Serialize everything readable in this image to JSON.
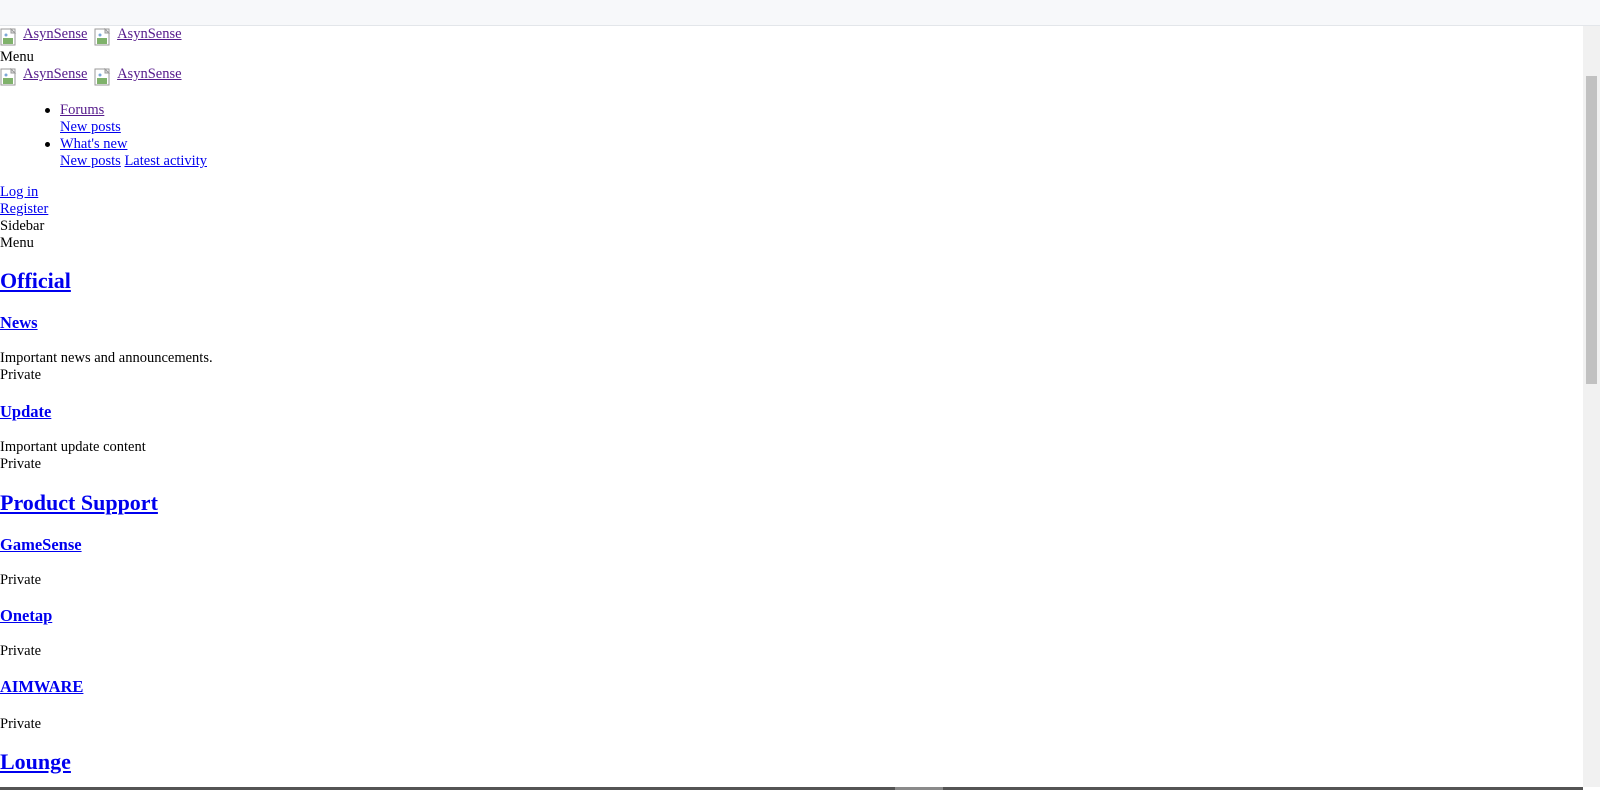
{
  "header": {
    "logo_alt": "AsynSense",
    "menu_label": "Menu"
  },
  "nav": {
    "forums": "Forums",
    "forums_new_posts": "New posts",
    "whats_new": "What's new",
    "whats_new_new_posts": "New posts",
    "latest_activity": "Latest activity"
  },
  "account": {
    "login": "Log in",
    "register": "Register"
  },
  "offcanvas": {
    "sidebar_label": "Sidebar",
    "menu_label": "Menu"
  },
  "categories": [
    {
      "title": "Official",
      "forums": [
        {
          "title": "News",
          "description": "Important news and announcements.",
          "status": "Private"
        },
        {
          "title": "Update",
          "description": "Important update content",
          "status": "Private"
        }
      ]
    },
    {
      "title": "Product Support",
      "forums": [
        {
          "title": "GameSense",
          "status": "Private"
        },
        {
          "title": "Onetap",
          "status": "Private"
        },
        {
          "title": "AIMWARE",
          "status": "Private"
        }
      ]
    },
    {
      "title": "Lounge"
    }
  ],
  "colors": {
    "link": "#0000ee",
    "visited_link": "#551a8b",
    "topbar_bg": "#f7f8fa",
    "scrollbar_track": "#f1f1f1",
    "scrollbar_thumb": "#c1c1c1"
  }
}
